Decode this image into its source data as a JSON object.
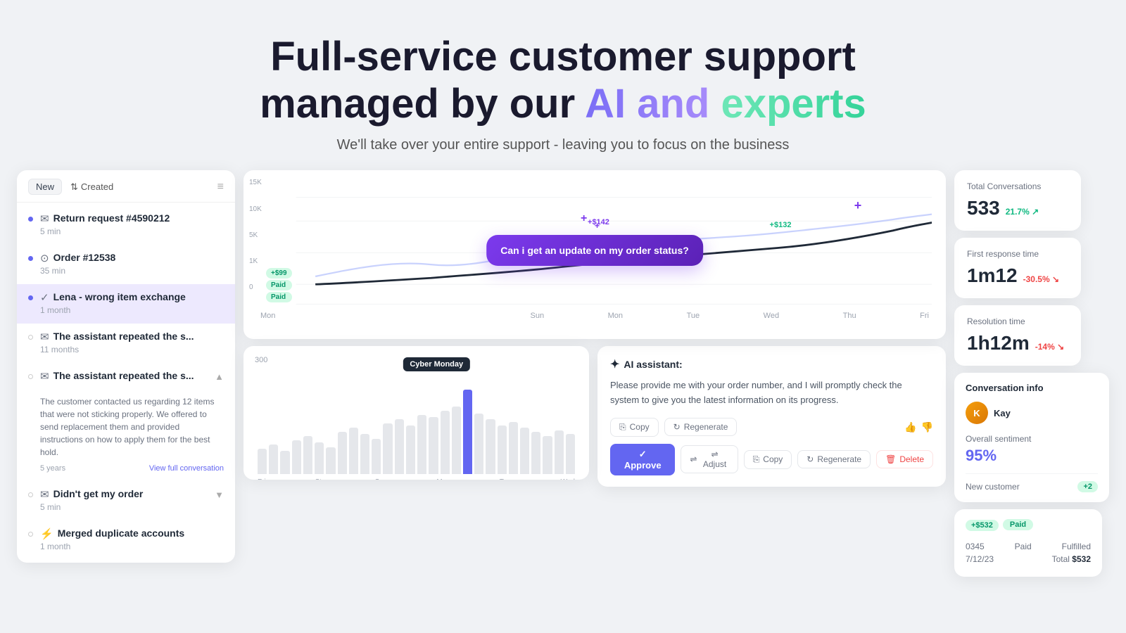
{
  "hero": {
    "title_part1": "Full-service customer support",
    "title_part2": "managed by our ",
    "title_ai": "AI and",
    "title_experts": "experts",
    "subtitle": "We'll take over your entire support - leaving you to focus on the business"
  },
  "left_panel": {
    "badge": "New",
    "sort_label": "Created",
    "conversations": [
      {
        "id": "conv-1",
        "title": "Return request #4590212",
        "time": "5 min",
        "icon": "✉",
        "has_dot": true,
        "active": false
      },
      {
        "id": "conv-2",
        "title": "Order #12538",
        "time": "35 min",
        "icon": "⊙",
        "has_dot": true,
        "active": false
      },
      {
        "id": "conv-3",
        "title": "Lena - wrong item exchange",
        "time": "1 month",
        "icon": "✓",
        "has_dot": true,
        "active": true
      },
      {
        "id": "conv-4",
        "title": "The assistant repeated the s...",
        "time": "11 months",
        "icon": "✉",
        "has_dot": false,
        "active": false
      },
      {
        "id": "conv-5",
        "title": "The assistant repeated the s...",
        "time": "5 years",
        "icon": "✉",
        "has_dot": false,
        "active": false,
        "expanded": true,
        "expanded_text": "The customer contacted us regarding 12 items that were not sticking properly. We offered to send replacement them and provided instructions on how to apply them for the best hold.",
        "view_label": "View full conversation"
      },
      {
        "id": "conv-6",
        "title": "Didn't get my order",
        "time": "5 min",
        "icon": "✉",
        "has_dot": false,
        "active": false
      },
      {
        "id": "conv-7",
        "title": "Merged duplicate accounts",
        "time": "1 month",
        "icon": "⚡",
        "has_dot": false,
        "active": false
      }
    ]
  },
  "chart": {
    "y_labels": [
      "15K",
      "10K",
      "5K",
      "1K",
      "0"
    ],
    "x_labels": [
      "Mon",
      "",
      "",
      "",
      "Sun",
      "Mon",
      "Tue",
      "Wed",
      "Thu",
      "Fri"
    ],
    "price_labels": [
      {
        "text": "+$142",
        "color": "purple"
      },
      {
        "text": "+$132",
        "color": "green"
      }
    ],
    "chat_bubble": "Can i get an update on my order status?"
  },
  "bar_chart": {
    "cyber_monday_label": "Cyber Monday",
    "x_labels": [
      "Fri",
      "Sta",
      "Sun",
      "Mon",
      "Tue",
      "Wed"
    ],
    "value_label": "300"
  },
  "ai_assistant": {
    "header": "AI assistant:",
    "text": "Please provide me with your order number, and I will promptly check the system to give you the latest information on its progress.",
    "copy_label": "Copy",
    "regenerate_label": "Regenerate",
    "approve_label": "✓ Approve",
    "adjust_label": "⇌ Adjust",
    "copy2_label": "Copy",
    "regenerate2_label": "Regenerate",
    "delete_label": "Delete"
  },
  "stats": {
    "total_conversations": {
      "label": "Total Conversations",
      "value": "533",
      "change": "21.7% ↗",
      "change_type": "positive"
    },
    "first_response": {
      "label": "First response time",
      "value": "1m12",
      "change": "-30.5% ↘",
      "change_type": "negative"
    },
    "resolution": {
      "label": "Resolution time",
      "value": "1h12m",
      "change": "-14% ↘",
      "change_type": "negative"
    }
  },
  "conv_info": {
    "title": "Conversation info",
    "agent_name": "Kay",
    "overall_sentiment_label": "Overall sentiment",
    "overall_sentiment_value": "95%",
    "new_customer_label": "New customer",
    "new_customer_badge": "+2"
  },
  "order": {
    "amount_badge": "+$532",
    "paid_badge": "Paid",
    "rows": [
      {
        "label": "0345",
        "value": "Paid"
      },
      {
        "label": "Fulfilled",
        "value": ""
      },
      {
        "label": "7/12/23",
        "value": ""
      },
      {
        "label": "Total",
        "value": "$532"
      }
    ]
  },
  "payment_badges": [
    {
      "text": "+$99",
      "color": "green"
    },
    {
      "text": "Paid",
      "color": "green"
    },
    {
      "text": "Paid",
      "color": "green"
    }
  ]
}
